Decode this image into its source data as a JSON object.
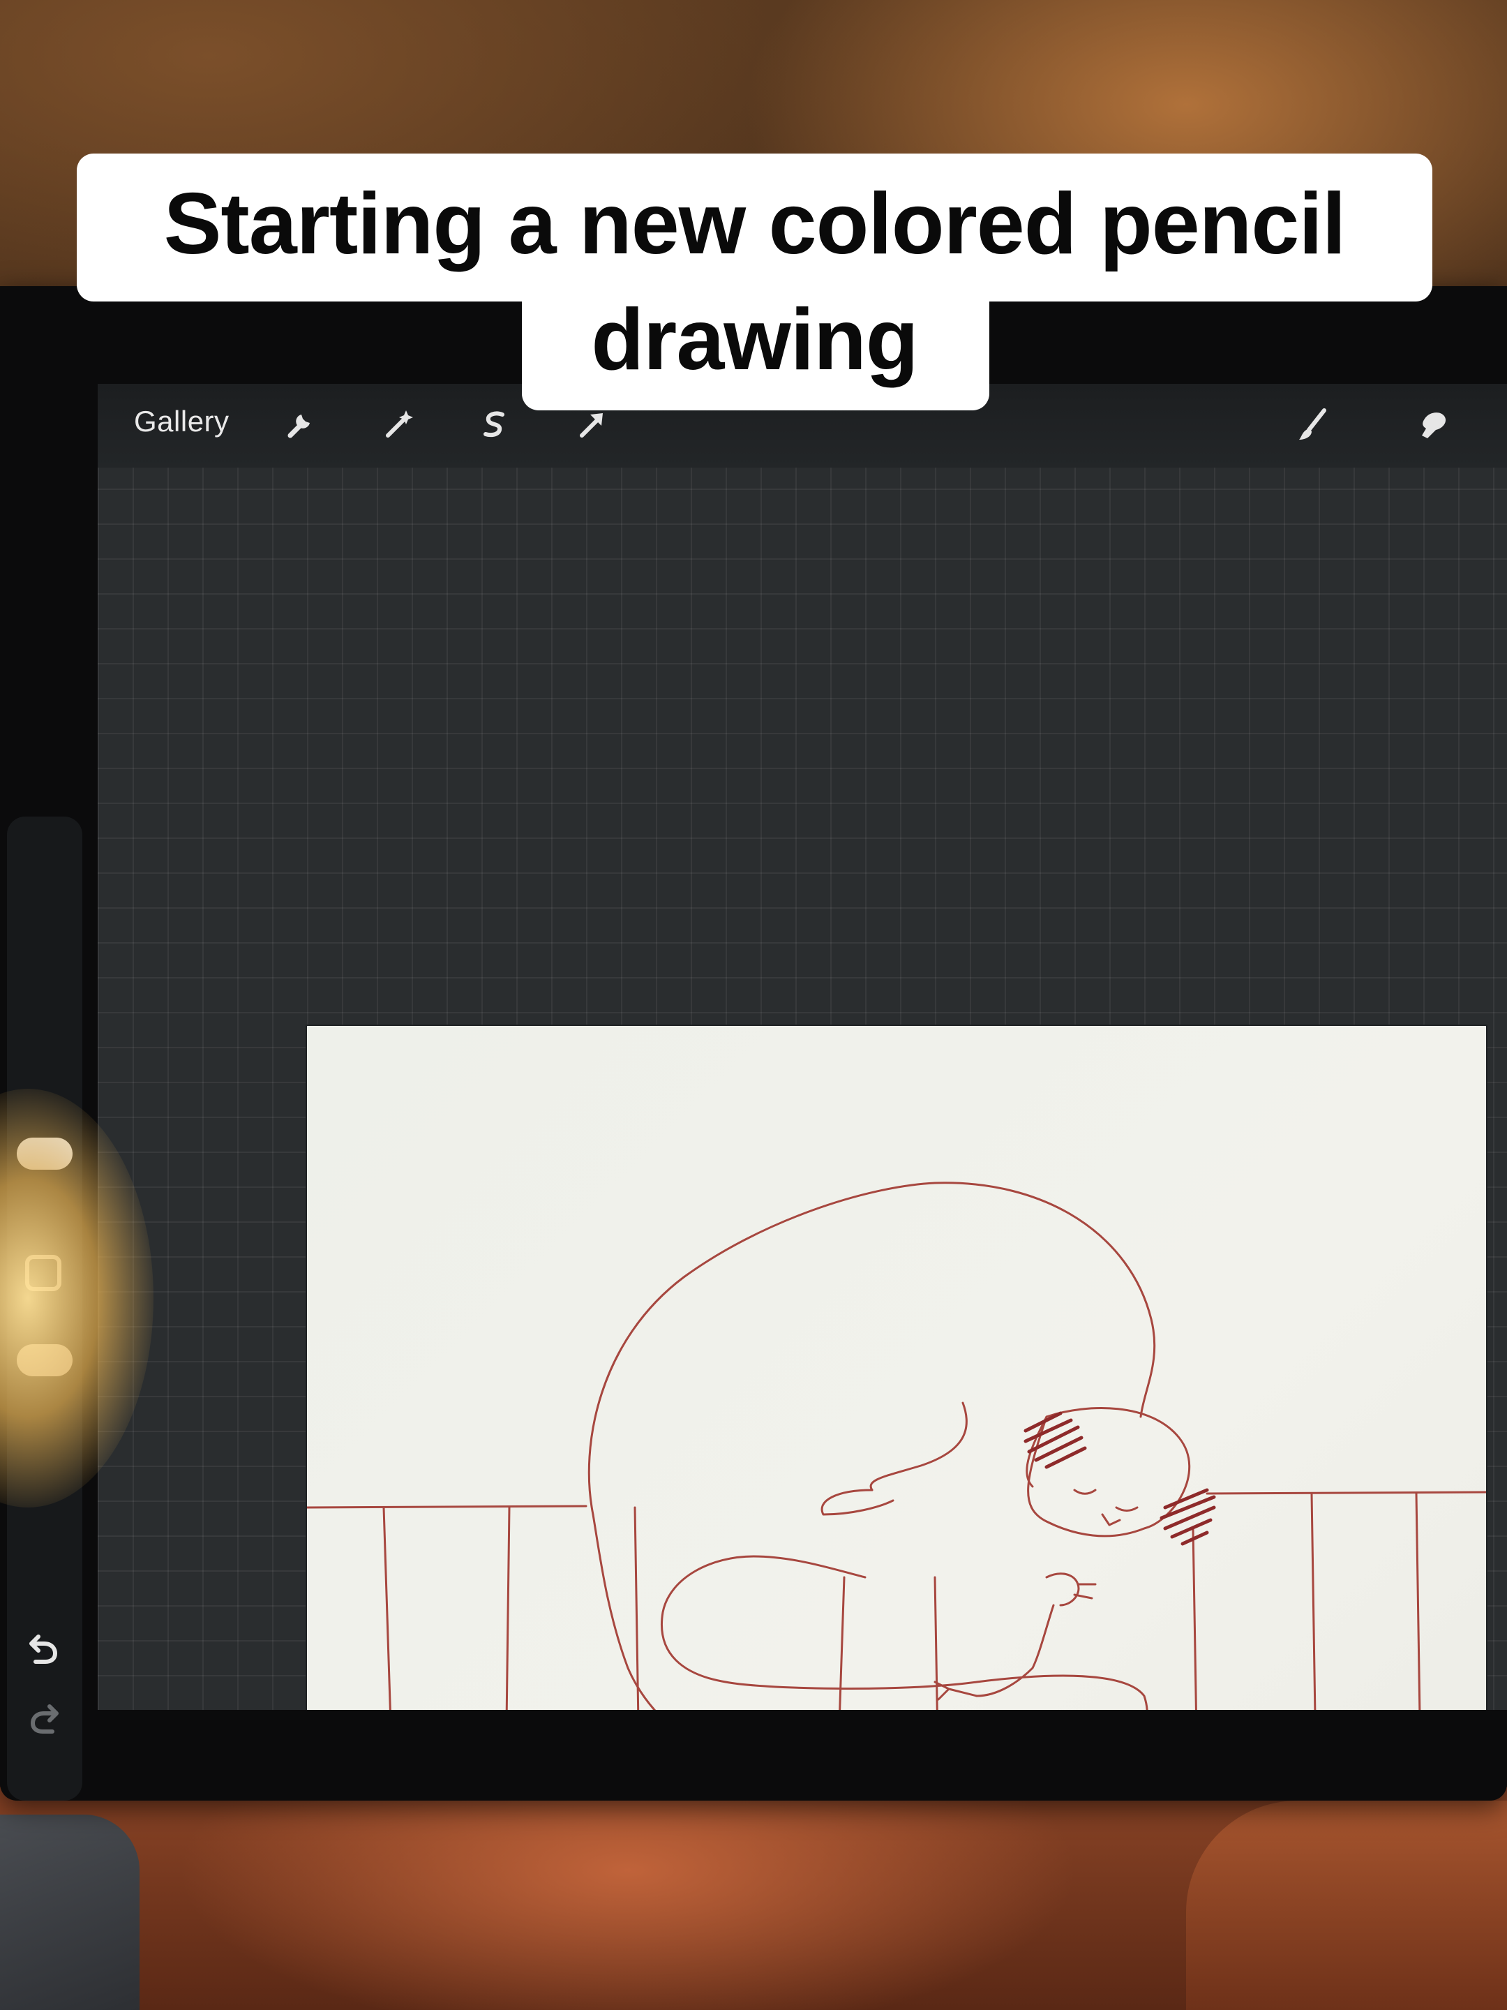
{
  "caption": {
    "line1": "Starting a new colored pencil",
    "line2": "drawing"
  },
  "app": {
    "toolbar": {
      "gallery_label": "Gallery",
      "left_tools": [
        "wrench-icon",
        "magic-wand-icon",
        "selection-icon",
        "transform-arrow-icon"
      ],
      "right_tools": [
        "brush-icon",
        "smudge-icon"
      ]
    },
    "sidebar": {
      "size_slider_icon": "slider-thumb",
      "modify_button_icon": "square-icon",
      "opacity_slider_icon": "slider-thumb",
      "undo_icon": "undo-icon",
      "redo_icon": "redo-icon"
    },
    "canvas": {
      "subject": "sketch",
      "stroke_color": "#a7473f",
      "shading_color": "#8e2a2a"
    }
  }
}
